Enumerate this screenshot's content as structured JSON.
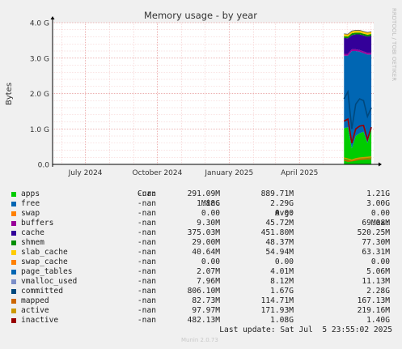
{
  "chart_data": {
    "type": "area",
    "title": "Memory usage - by year",
    "ylabel": "Bytes",
    "side_label": "RRDTOOL / TOBI OETIKER",
    "ylim": [
      0,
      4.0
    ],
    "yticks": [
      "0.0",
      "1.0 G",
      "2.0 G",
      "3.0 G",
      "4.0 G"
    ],
    "ytick_values": [
      0,
      1,
      2,
      3,
      4
    ],
    "xlim": [
      "2024-05-20",
      "2025-07-05"
    ],
    "xticks": [
      {
        "label": "July 2024",
        "date": "2024-07-01"
      },
      {
        "label": "October 2024",
        "date": "2024-10-01"
      },
      {
        "label": "January 2025",
        "date": "2025-01-01"
      },
      {
        "label": "April 2025",
        "date": "2025-04-01"
      }
    ],
    "x": [
      "2025-05-28",
      "2025-06-02",
      "2025-06-07",
      "2025-06-12",
      "2025-06-17",
      "2025-06-22",
      "2025-06-27",
      "2025-07-02"
    ],
    "stack": [
      {
        "name": "apps",
        "color": "#00cc00",
        "values": [
          1.02,
          1.05,
          0.45,
          0.8,
          0.88,
          0.92,
          0.6,
          0.98
        ]
      },
      {
        "name": "free",
        "color": "#0066b3",
        "values": [
          2.05,
          2.02,
          2.75,
          2.4,
          2.3,
          2.22,
          2.5,
          2.12
        ]
      },
      {
        "name": "buffers",
        "color": "#990099",
        "values": [
          0.05,
          0.05,
          0.05,
          0.05,
          0.05,
          0.05,
          0.05,
          0.05
        ]
      },
      {
        "name": "cache",
        "color": "#330099",
        "values": [
          0.45,
          0.44,
          0.4,
          0.42,
          0.44,
          0.45,
          0.46,
          0.48
        ]
      },
      {
        "name": "shmem",
        "color": "#008f00",
        "values": [
          0.05,
          0.05,
          0.05,
          0.05,
          0.05,
          0.05,
          0.05,
          0.05
        ]
      },
      {
        "name": "slab_cache",
        "color": "#ffcc00",
        "values": [
          0.06,
          0.06,
          0.06,
          0.06,
          0.06,
          0.06,
          0.06,
          0.06
        ]
      },
      {
        "name": "page_tables",
        "color": "#0066b3",
        "values": [
          0.005,
          0.005,
          0.005,
          0.005,
          0.005,
          0.005,
          0.005,
          0.005
        ]
      }
    ],
    "lines": [
      {
        "name": "committed",
        "color": "#00487d",
        "values": [
          1.85,
          2.05,
          1.0,
          1.7,
          1.85,
          1.8,
          1.35,
          1.6
        ]
      },
      {
        "name": "mapped",
        "color": "#cc6600",
        "values": [
          0.12,
          0.09,
          0.1,
          0.12,
          0.14,
          0.15,
          0.16,
          0.16
        ]
      },
      {
        "name": "active",
        "color": "#cc9900",
        "values": [
          0.18,
          0.15,
          0.12,
          0.16,
          0.18,
          0.19,
          0.2,
          0.21
        ]
      },
      {
        "name": "inactive",
        "color": "#990000",
        "values": [
          1.22,
          1.28,
          0.6,
          1.0,
          1.08,
          1.1,
          0.7,
          1.05
        ]
      }
    ]
  },
  "legend": {
    "header": {
      "cur": "Cur:",
      "min": "Min:",
      "avg": "Avg:",
      "max": "Max:"
    },
    "rows": [
      {
        "name": "apps",
        "color": "#00cc00",
        "cur": "-nan",
        "min": "291.09M",
        "avg": "889.71M",
        "max": "1.21G"
      },
      {
        "name": "free",
        "color": "#0066b3",
        "cur": "-nan",
        "min": "1.88G",
        "avg": "2.29G",
        "max": "3.00G"
      },
      {
        "name": "swap",
        "color": "#ff8000",
        "cur": "-nan",
        "min": "0.00",
        "avg": "0.00",
        "max": "0.00"
      },
      {
        "name": "buffers",
        "color": "#990099",
        "cur": "-nan",
        "min": "9.30M",
        "avg": "45.72M",
        "max": "69.08M"
      },
      {
        "name": "cache",
        "color": "#330099",
        "cur": "-nan",
        "min": "375.03M",
        "avg": "451.80M",
        "max": "520.25M"
      },
      {
        "name": "shmem",
        "color": "#008f00",
        "cur": "-nan",
        "min": "29.00M",
        "avg": "48.37M",
        "max": "77.30M"
      },
      {
        "name": "slab_cache",
        "color": "#ffcc00",
        "cur": "-nan",
        "min": "40.64M",
        "avg": "54.94M",
        "max": "63.31M"
      },
      {
        "name": "swap_cache",
        "color": "#ff8000",
        "cur": "-nan",
        "min": "0.00",
        "avg": "0.00",
        "max": "0.00"
      },
      {
        "name": "page_tables",
        "color": "#0066b3",
        "cur": "-nan",
        "min": "2.07M",
        "avg": "4.01M",
        "max": "5.06M"
      },
      {
        "name": "vmalloc_used",
        "color": "#7b8ec8",
        "cur": "-nan",
        "min": "7.96M",
        "avg": "8.12M",
        "max": "11.13M"
      },
      {
        "name": "committed",
        "color": "#00487d",
        "cur": "-nan",
        "min": "806.10M",
        "avg": "1.67G",
        "max": "2.28G"
      },
      {
        "name": "mapped",
        "color": "#cc6600",
        "cur": "-nan",
        "min": "82.73M",
        "avg": "114.71M",
        "max": "167.13M"
      },
      {
        "name": "active",
        "color": "#cc9900",
        "cur": "-nan",
        "min": "97.97M",
        "avg": "171.93M",
        "max": "219.16M"
      },
      {
        "name": "inactive",
        "color": "#990000",
        "cur": "-nan",
        "min": "482.13M",
        "avg": "1.08G",
        "max": "1.40G"
      }
    ]
  },
  "footer": {
    "last_update": "Last update: Sat Jul  5 23:55:02 2025",
    "munin": "Munin 2.0.73"
  }
}
